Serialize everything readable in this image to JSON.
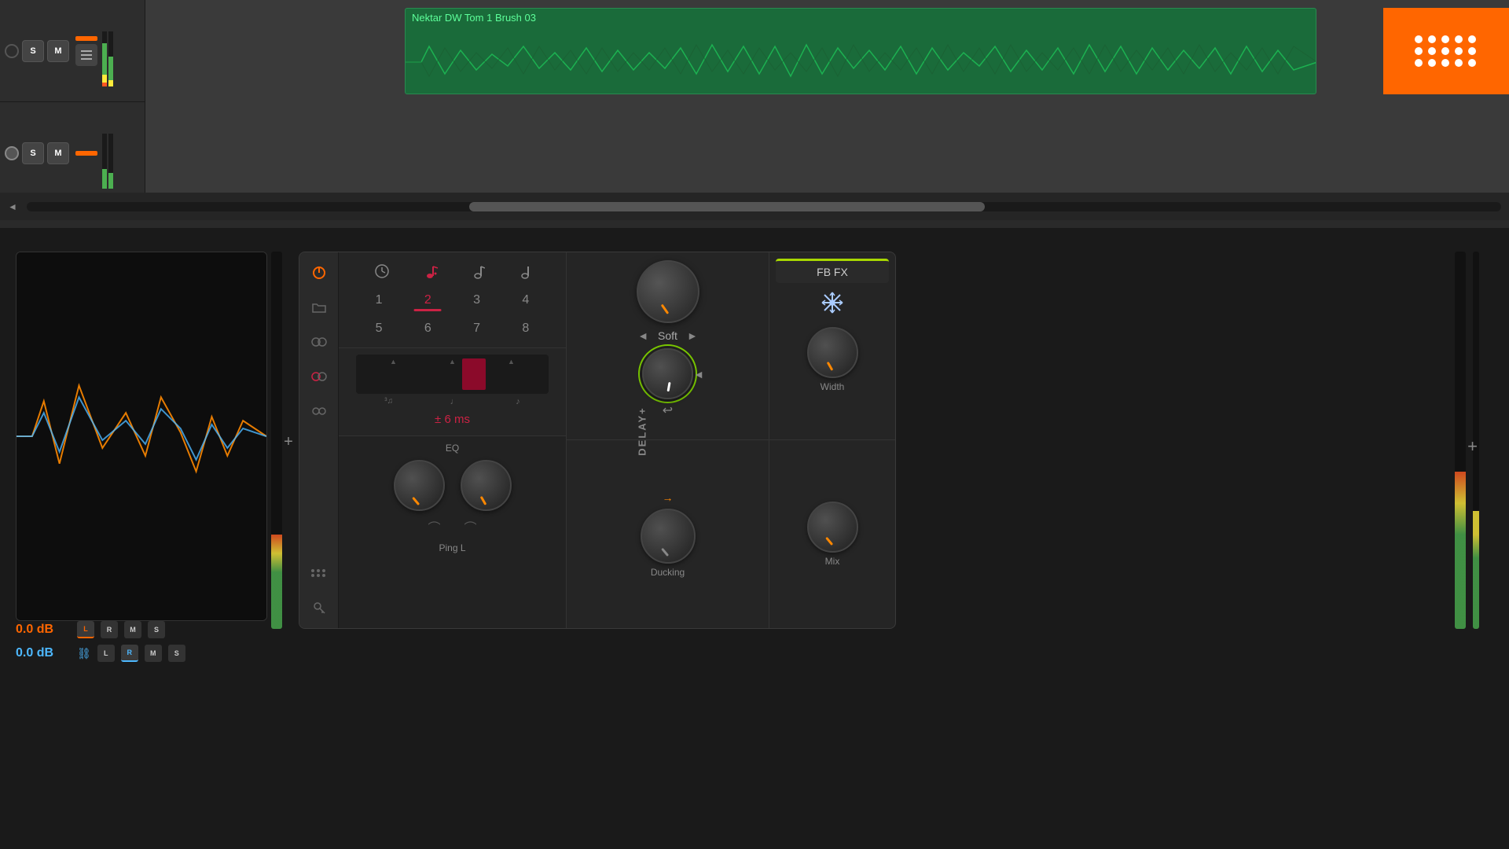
{
  "daw": {
    "track1": {
      "label": "Nektar DW Tom 1 Brush 03",
      "s_btn": "S",
      "m_btn": "M"
    },
    "track2": {
      "s_btn": "S",
      "m_btn": "M"
    }
  },
  "analyzer": {
    "db1_label": "0.0 dB",
    "db2_label": "0.0 dB",
    "channel_l": "L",
    "channel_r": "R",
    "channel_m": "M",
    "channel_s": "S",
    "channel_l2": "L",
    "channel_r2": "R",
    "channel_m2": "M",
    "channel_s2": "S"
  },
  "delay_plugin": {
    "name": "DELAY+",
    "channel_label": "Ping L",
    "timing": {
      "numbers": [
        "1",
        "2",
        "3",
        "4",
        "5",
        "6",
        "7",
        "8"
      ],
      "active_number": "2",
      "ms_display": "± 6 ms"
    },
    "soft": {
      "label": "Soft"
    },
    "eq": {
      "label": "EQ"
    },
    "fbfx": {
      "label": "FB FX"
    },
    "width": {
      "label": "Width"
    },
    "ducking": {
      "label": "Ducking"
    },
    "mix": {
      "label": "Mix"
    }
  },
  "colors": {
    "orange": "#ff6600",
    "green_accent": "#a8d800",
    "red_active": "#cc2244",
    "blue_channel": "#4db8ff",
    "knob_green_ring": "#7ac800"
  }
}
